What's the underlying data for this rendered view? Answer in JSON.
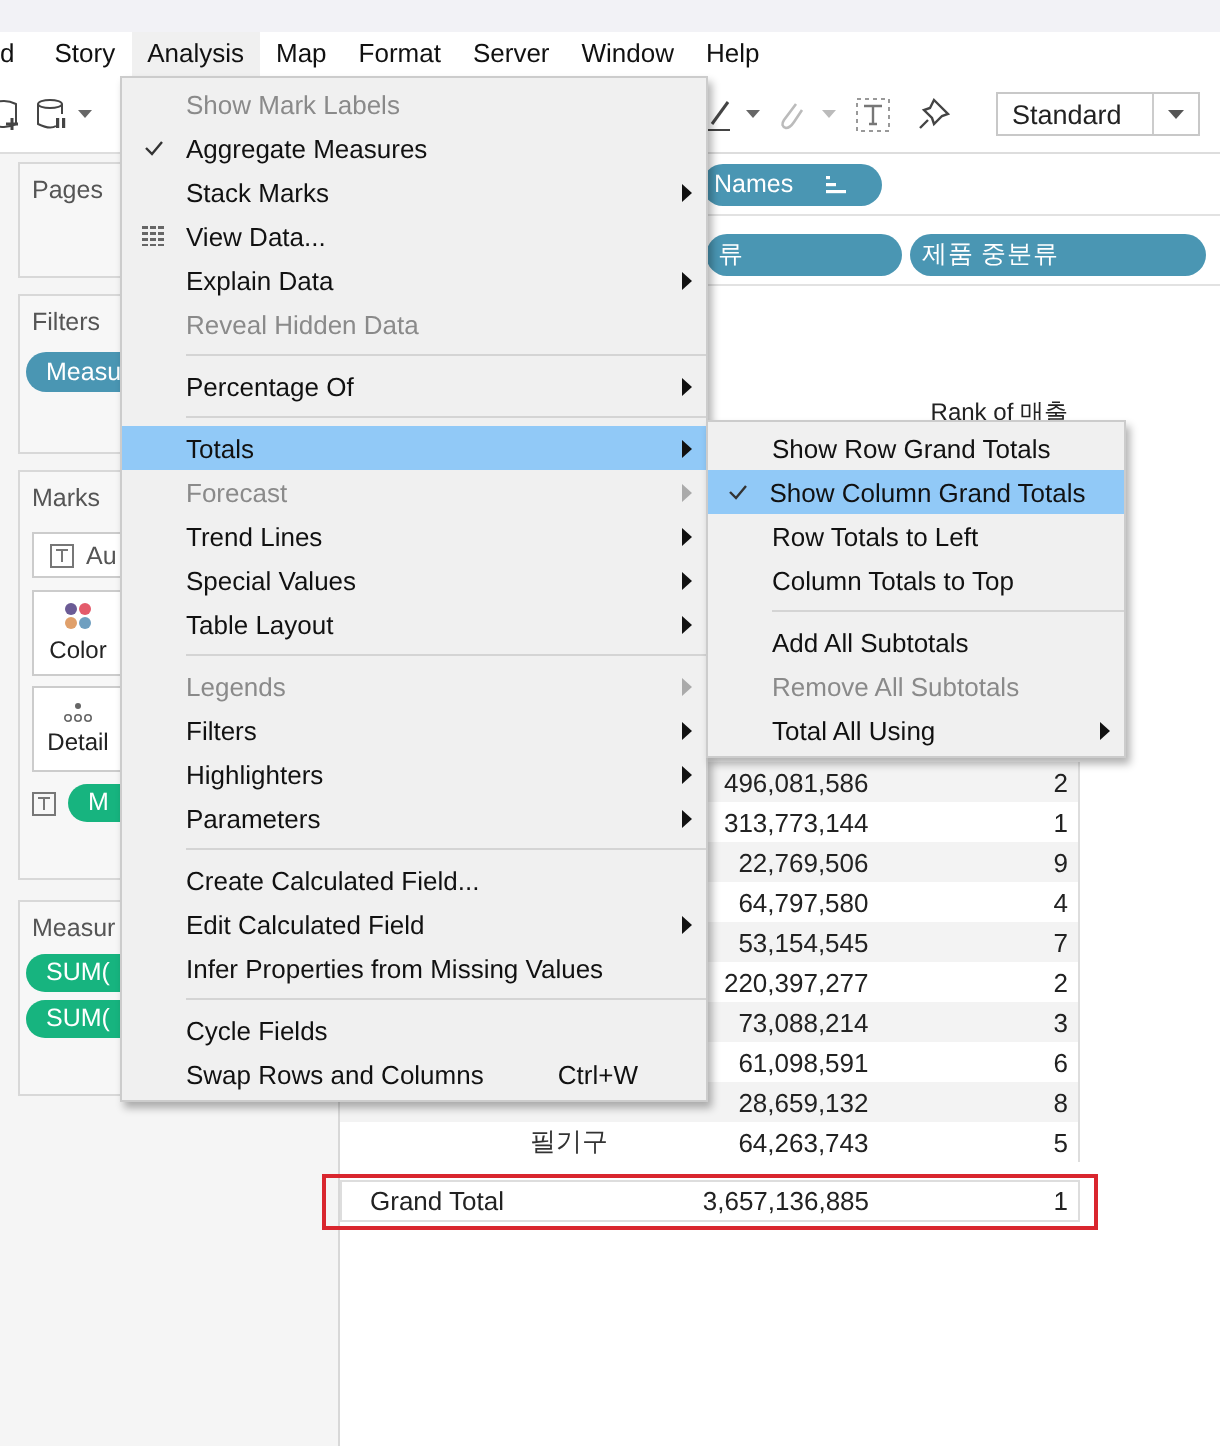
{
  "menubar": [
    {
      "label": "d",
      "open": false
    },
    {
      "label": "Story",
      "open": false
    },
    {
      "label": "Analysis",
      "open": true
    },
    {
      "label": "Map",
      "open": false
    },
    {
      "label": "Format",
      "open": false
    },
    {
      "label": "Server",
      "open": false
    },
    {
      "label": "Window",
      "open": false
    },
    {
      "label": "Help",
      "open": false
    }
  ],
  "toolbar": {
    "view_size": "Standard"
  },
  "left_pane": {
    "pages": {
      "title": "Pages"
    },
    "filters": {
      "title": "Filters",
      "pills": [
        "Measu"
      ]
    },
    "marks": {
      "title": "Marks",
      "mark_type": "Au",
      "buttons": [
        {
          "label": "Color",
          "kind": "color"
        },
        {
          "label": "Detail",
          "kind": "detail"
        }
      ],
      "text_pill": "M"
    },
    "measure_values": {
      "title": "Measur",
      "pills": [
        "SUM(",
        "SUM("
      ]
    }
  },
  "shelves": {
    "columns": [
      {
        "label": "Names",
        "sorted": true
      }
    ],
    "rows": [
      {
        "label": "류",
        "sorted": false
      },
      {
        "label": "제품 중분류",
        "sorted": false
      }
    ]
  },
  "table": {
    "header": "Rank of 매출",
    "rows": [
      {
        "value": "496,081,586",
        "rank": "2"
      },
      {
        "value": "313,773,144",
        "rank": "1"
      },
      {
        "value": "22,769,506",
        "rank": "9"
      },
      {
        "value": "64,797,580",
        "rank": "4"
      },
      {
        "value": "53,154,545",
        "rank": "7"
      },
      {
        "value": "220,397,277",
        "rank": "2"
      },
      {
        "value": "73,088,214",
        "rank": "3"
      },
      {
        "value": "61,098,591",
        "rank": "6"
      },
      {
        "value": "28,659,132",
        "rank": "8"
      },
      {
        "label": "필기구",
        "value": "64,263,743",
        "rank": "5"
      }
    ],
    "grand_total": {
      "label": "Grand Total",
      "value": "3,657,136,885",
      "rank": "1",
      "highlighted": true
    }
  },
  "analysis_menu": {
    "groups": [
      [
        {
          "label": "Show Mark Labels",
          "kind": "plain",
          "checked": false,
          "disabled": true,
          "submenu": false,
          "selected": false
        },
        {
          "label": "Aggregate Measures",
          "kind": "plain",
          "checked": true,
          "disabled": false,
          "submenu": false,
          "selected": false
        },
        {
          "label": "Stack Marks",
          "kind": "plain",
          "checked": false,
          "disabled": false,
          "submenu": true,
          "selected": false
        },
        {
          "label": "View Data...",
          "kind": "iconed",
          "checked": false,
          "disabled": false,
          "submenu": false,
          "selected": false
        },
        {
          "label": "Explain Data",
          "kind": "plain",
          "checked": false,
          "disabled": false,
          "submenu": true,
          "selected": false
        },
        {
          "label": "Reveal Hidden Data",
          "kind": "plain",
          "checked": false,
          "disabled": true,
          "submenu": false,
          "selected": false
        }
      ],
      [
        {
          "label": "Percentage Of",
          "kind": "plain",
          "checked": false,
          "disabled": false,
          "submenu": true,
          "selected": false
        }
      ],
      [
        {
          "label": "Totals",
          "kind": "plain",
          "checked": false,
          "disabled": false,
          "submenu": true,
          "selected": true
        },
        {
          "label": "Forecast",
          "kind": "plain",
          "checked": false,
          "disabled": true,
          "submenu": true,
          "selected": false
        },
        {
          "label": "Trend Lines",
          "kind": "plain",
          "checked": false,
          "disabled": false,
          "submenu": true,
          "selected": false
        },
        {
          "label": "Special Values",
          "kind": "plain",
          "checked": false,
          "disabled": false,
          "submenu": true,
          "selected": false
        },
        {
          "label": "Table Layout",
          "kind": "plain",
          "checked": false,
          "disabled": false,
          "submenu": true,
          "selected": false
        }
      ],
      [
        {
          "label": "Legends",
          "kind": "plain",
          "checked": false,
          "disabled": true,
          "submenu": true,
          "selected": false
        },
        {
          "label": "Filters",
          "kind": "plain",
          "checked": false,
          "disabled": false,
          "submenu": true,
          "selected": false
        },
        {
          "label": "Highlighters",
          "kind": "plain",
          "checked": false,
          "disabled": false,
          "submenu": true,
          "selected": false
        },
        {
          "label": "Parameters",
          "kind": "plain",
          "checked": false,
          "disabled": false,
          "submenu": true,
          "selected": false
        }
      ],
      [
        {
          "label": "Create Calculated Field...",
          "kind": "plain",
          "checked": false,
          "disabled": false,
          "submenu": false,
          "selected": false
        },
        {
          "label": "Edit Calculated Field",
          "kind": "plain",
          "checked": false,
          "disabled": false,
          "submenu": true,
          "selected": false
        },
        {
          "label": "Infer Properties from Missing Values",
          "kind": "plain",
          "checked": false,
          "disabled": false,
          "submenu": false,
          "selected": false
        }
      ],
      [
        {
          "label": "Cycle Fields",
          "kind": "plain",
          "checked": false,
          "disabled": false,
          "submenu": false,
          "selected": false
        },
        {
          "label": "Swap Rows and Columns",
          "kind": "plain",
          "checked": false,
          "disabled": false,
          "submenu": false,
          "selected": false,
          "shortcut": "Ctrl+W"
        }
      ]
    ]
  },
  "totals_submenu": {
    "groups": [
      [
        {
          "label": "Show Row Grand Totals",
          "checked": false,
          "disabled": false,
          "submenu": false,
          "selected": false
        },
        {
          "label": "Show Column Grand Totals",
          "checked": true,
          "disabled": false,
          "submenu": false,
          "selected": true
        },
        {
          "label": "Row Totals to Left",
          "checked": false,
          "disabled": false,
          "submenu": false,
          "selected": false
        },
        {
          "label": "Column Totals to Top",
          "checked": false,
          "disabled": false,
          "submenu": false,
          "selected": false
        }
      ],
      [
        {
          "label": "Add All Subtotals",
          "checked": false,
          "disabled": false,
          "submenu": false,
          "selected": false
        },
        {
          "label": "Remove All Subtotals",
          "checked": false,
          "disabled": true,
          "submenu": false,
          "selected": false
        },
        {
          "label": "Total All Using",
          "checked": false,
          "disabled": false,
          "submenu": true,
          "selected": false
        }
      ]
    ]
  }
}
